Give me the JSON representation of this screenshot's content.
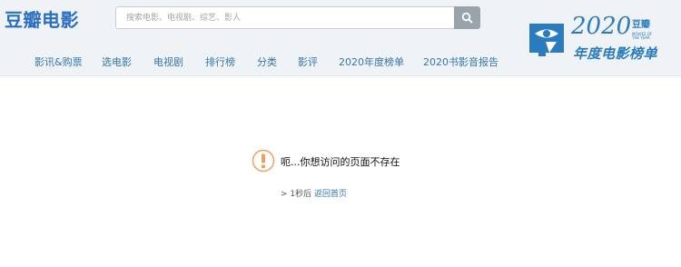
{
  "header": {
    "logo_text": "豆瓣电影",
    "search_placeholder": "搜索电影、电视剧、综艺、影人"
  },
  "nav": [
    "影讯&购票",
    "选电影",
    "电视剧",
    "排行榜",
    "分类",
    "影评",
    "2020年度榜单",
    "2020书影音报告"
  ],
  "banner": {
    "year": "2020",
    "brand": "豆瓣",
    "subtitle": "MOVIES OF THE YEAR",
    "title": "年度电影榜单"
  },
  "error": {
    "message": "呃...你想访问的页面不存在",
    "redirect_prefix": "> 1秒后",
    "redirect_link": "返回首页"
  },
  "colors": {
    "brand_blue": "#2a6fc1",
    "link": "#3377aa",
    "warning": "#f29e5c",
    "header_bg": "#f0f3f5"
  }
}
